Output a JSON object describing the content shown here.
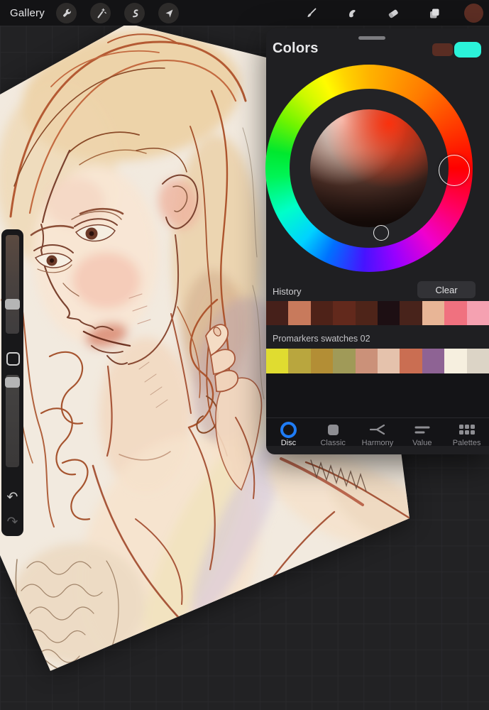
{
  "toolbar": {
    "gallery_label": "Gallery",
    "left_tools": [
      "wrench",
      "magic-wand",
      "selection",
      "transform"
    ],
    "right_tools": [
      "paint-brush",
      "smudge",
      "eraser",
      "layers"
    ],
    "active_color": "#5d2e24"
  },
  "sidebar": {
    "undo_glyph": "↶",
    "redo_glyph": "↷"
  },
  "colors_panel": {
    "title": "Colors",
    "current_color": "#5a2d23",
    "secondary_color": "#2bf2d9",
    "wheel_selected_color": "#ff2000",
    "history": {
      "label": "History",
      "clear_label": "Clear",
      "swatches": [
        "#46201a",
        "#c87a5c",
        "#4e2218",
        "#62291c",
        "#4e2419",
        "#1d0f13",
        "#48231b",
        "#e8b596",
        "#f0717f",
        "#f5a1b1"
      ]
    },
    "palette": {
      "name": "Promarkers swatches 02",
      "swatches": [
        "#e0dc30",
        "#b9a63e",
        "#b38e35",
        "#a09a58",
        "#cb9179",
        "#e5c2ac",
        "#ca6e52",
        "#8e6394",
        "#f6efdf",
        "#dcd4c6"
      ]
    },
    "tabs": [
      {
        "label": "Disc",
        "active": true
      },
      {
        "label": "Classic",
        "active": false
      },
      {
        "label": "Harmony",
        "active": false
      },
      {
        "label": "Value",
        "active": false
      },
      {
        "label": "Palettes",
        "active": false
      }
    ],
    "accent": "#1f7cf5"
  }
}
